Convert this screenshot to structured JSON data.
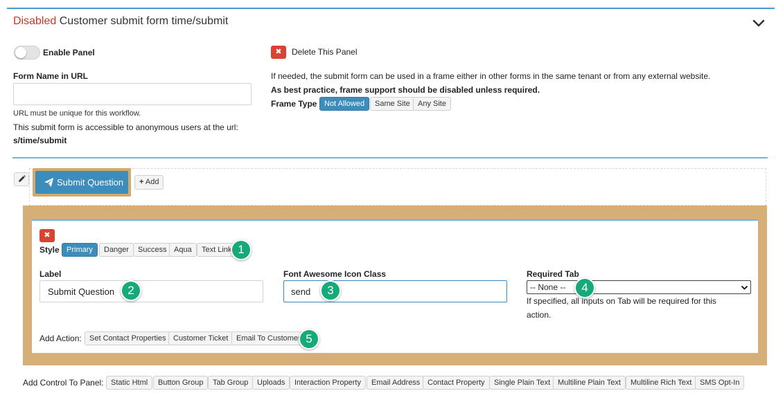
{
  "header": {
    "status": "Disabled",
    "title": "Customer submit form time/submit"
  },
  "panel": {
    "enable_label": "Enable Panel",
    "delete_label": "Delete This Panel",
    "form_name_label": "Form Name in URL",
    "form_name_value": "",
    "url_hint": "URL must be unique for this workflow.",
    "anon_text": "This submit form is accessible to anonymous users at the url:",
    "url_path": "s/time/submit",
    "frame_info": "If needed, the submit form can be used in a frame either in other forms in the same tenant or from any external website.",
    "frame_best_practice": "As best practice, frame support should be disabled unless required.",
    "frame_type_label": "Frame Type",
    "frame_options": [
      "Not Allowed",
      "Same Site",
      "Any Site"
    ],
    "frame_selected": "Not Allowed"
  },
  "button_row": {
    "submit_question_label": "Submit Question",
    "add_label": "Add"
  },
  "editor": {
    "style_label": "Style",
    "styles": [
      "Primary",
      "Danger",
      "Success",
      "Aqua",
      "Text Link"
    ],
    "style_selected": "Primary",
    "label_title": "Label",
    "label_value": "Submit Question",
    "icon_title": "Font Awesome Icon Class",
    "icon_value": "send",
    "required_tab_title": "Required Tab",
    "required_tab_value": "-- None --",
    "required_tab_hint_line1": "If specified, all inputs on Tab will be required for this",
    "required_tab_hint_line2": "action.",
    "add_action_label": "Add Action:",
    "actions": [
      "Set Contact Properties",
      "Customer Ticket",
      "Email To Customer"
    ]
  },
  "badges": [
    "1",
    "2",
    "3",
    "4",
    "5"
  ],
  "add_control": {
    "label": "Add Control To Panel:",
    "controls": [
      "Static Html",
      "Button Group",
      "Tab Group",
      "Uploads",
      "Interaction Property",
      "Email Address",
      "Contact Property",
      "Single Plain Text",
      "Multiline Plain Text",
      "Multiline Rich Text",
      "SMS Opt-In"
    ]
  },
  "colors": {
    "accent": "#3c8dbc",
    "danger": "#d9432f",
    "highlight": "#d6af78",
    "badge": "#16a97a",
    "disabled_text": "#c0392b"
  },
  "icons": [
    "chevron-down-icon",
    "close-icon",
    "pencil-icon",
    "paper-plane-icon",
    "plus-icon"
  ]
}
